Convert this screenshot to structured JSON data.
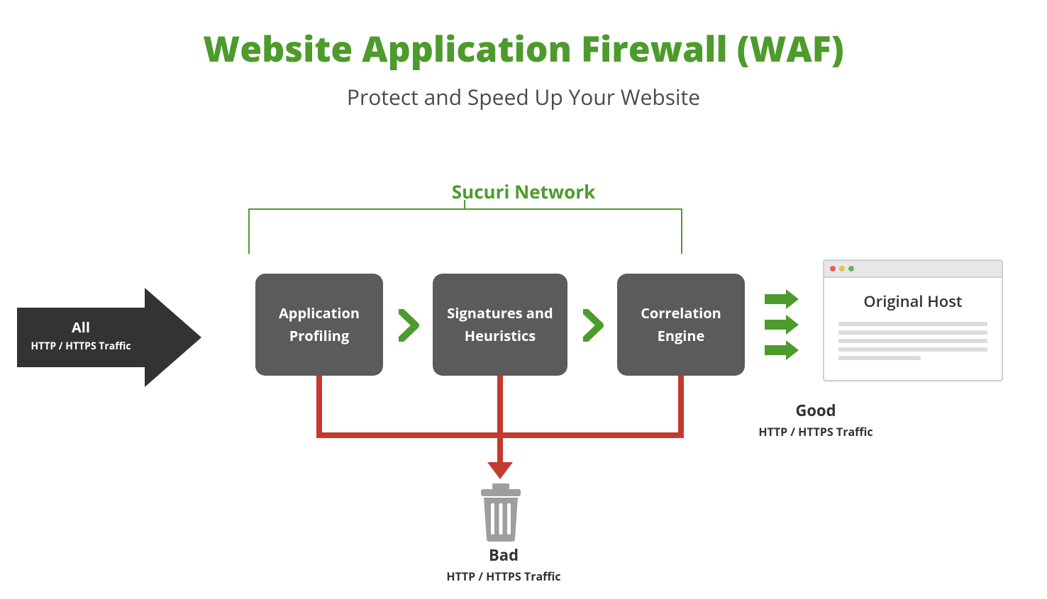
{
  "title": "Website Application Firewall (WAF)",
  "subtitle": "Protect and Speed Up Your Website",
  "network_label": "Sucuri Network",
  "input_arrow": {
    "line1": "All",
    "line2": "HTTP / HTTPS Traffic"
  },
  "stages": [
    "Application Profiling",
    "Signatures and Heuristics",
    "Correlation Engine"
  ],
  "browser": {
    "title": "Original Host"
  },
  "good": {
    "line1": "Good",
    "line2": "HTTP / HTTPS Traffic"
  },
  "bad": {
    "line1": "Bad",
    "line2": "HTTP / HTTPS Traffic"
  }
}
